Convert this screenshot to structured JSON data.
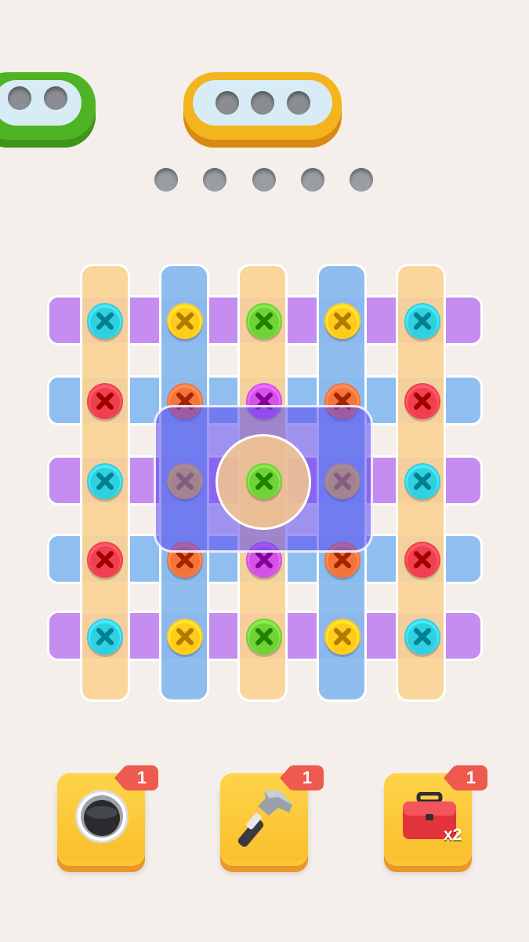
{
  "boxes": [
    {
      "name": "green-box",
      "color": "#62c72e",
      "rim": "#3f9b1a",
      "holes": 2
    },
    {
      "name": "yellow-box",
      "color": "#f7b81e",
      "rim": "#d9890f",
      "holes": 3
    }
  ],
  "pending_holes": 5,
  "plate_colors": {
    "purple": "#c78ef0",
    "blue": "#8fbff0",
    "orange": "#f8d49a",
    "vblue": "#8bbcee"
  },
  "screw_colors": {
    "cyan": "#2fd0e0",
    "yellow": "#ffcc1a",
    "green": "#6fd236",
    "red": "#f0404f",
    "orange": "#f5743a",
    "magenta": "#d452e6"
  },
  "screw_grid": [
    [
      "cyan",
      "yellow",
      "green",
      "yellow",
      "cyan"
    ],
    [
      "red",
      "orange",
      "magenta",
      "orange",
      "red"
    ],
    [
      "cyan",
      "yellow",
      "green",
      "yellow",
      "cyan"
    ],
    [
      "red",
      "orange",
      "magenta",
      "orange",
      "red"
    ],
    [
      "cyan",
      "yellow",
      "green",
      "yellow",
      "cyan"
    ]
  ],
  "tools": [
    {
      "name": "hole-tool",
      "badge": "1",
      "icon": "hole-icon"
    },
    {
      "name": "hammer-tool",
      "badge": "1",
      "icon": "hammer-icon"
    },
    {
      "name": "toolbox-tool",
      "badge": "1",
      "icon": "toolbox-icon",
      "multiplier": "x2"
    }
  ]
}
